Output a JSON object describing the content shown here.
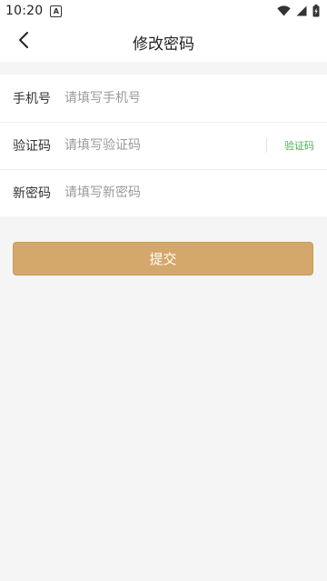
{
  "status_bar": {
    "time": "10:20",
    "app_icon_letter": "A"
  },
  "header": {
    "title": "修改密码"
  },
  "form": {
    "phone": {
      "label": "手机号",
      "value": "",
      "placeholder": "请填写手机号"
    },
    "code": {
      "label": "验证码",
      "value": "",
      "placeholder": "请填写验证码",
      "get_code_label": "验证码"
    },
    "new_password": {
      "label": "新密码",
      "value": "",
      "placeholder": "请填写新密码"
    }
  },
  "submit": {
    "label": "提交"
  },
  "colors": {
    "accent": "#d4a76a",
    "code_link": "#4caf50",
    "background": "#f5f5f5"
  },
  "icons": {
    "back": "chevron-left-icon",
    "wifi": "wifi-icon",
    "signal": "signal-icon",
    "battery": "battery-charging-icon"
  }
}
